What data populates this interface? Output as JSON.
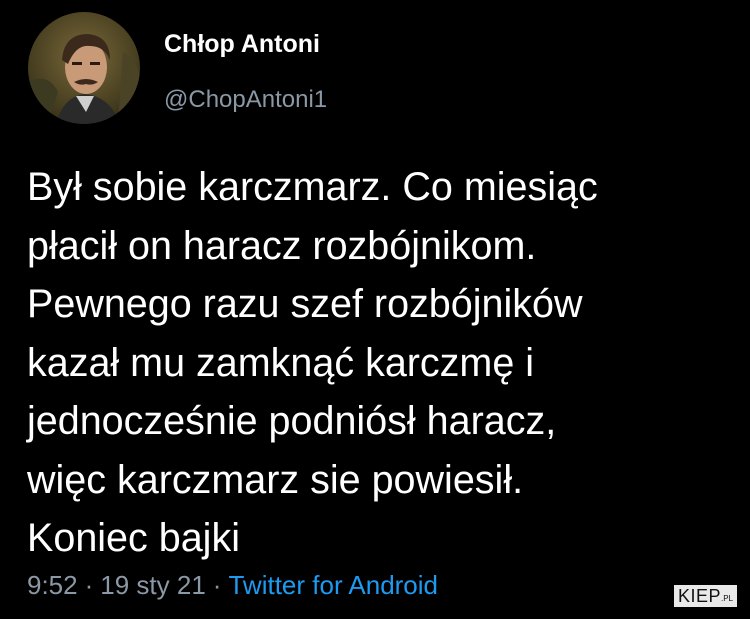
{
  "author": {
    "display_name": "Chłop Antoni",
    "handle": "@ChopAntoni1",
    "avatar_icon": "profile-photo-avatar"
  },
  "tweet": {
    "lines": [
      "Był sobie karczmarz. Co miesiąc",
      "płacił on haracz rozbójnikom.",
      "Pewnego razu szef rozbójników",
      "kazał mu zamknąć karczmę i",
      "jednocześnie podniósł haracz,",
      "więc karczmarz sie powiesił.",
      "Koniec bajki"
    ]
  },
  "meta": {
    "time": "9:52",
    "separator": "·",
    "date": "19 sty 21",
    "source": "Twitter for Android"
  },
  "watermark": {
    "brand": "KIEP",
    "suffix": ".PL"
  },
  "colors": {
    "background": "#000000",
    "text": "#ffffff",
    "muted": "#8b98a5",
    "link": "#1d9bf0"
  }
}
